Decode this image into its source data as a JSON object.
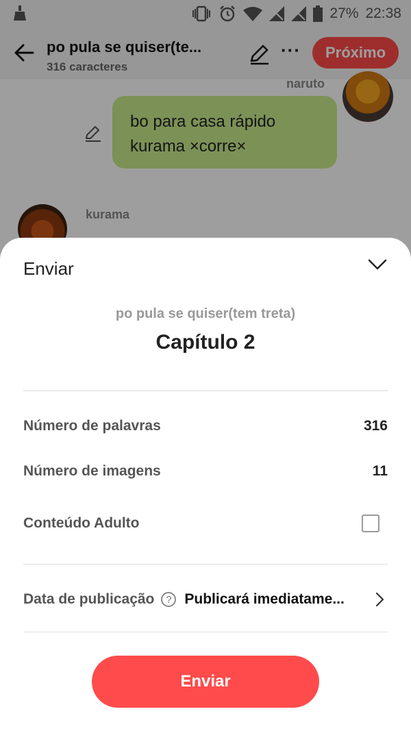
{
  "status_bar": {
    "battery": "27%",
    "time": "22:38"
  },
  "header": {
    "title": "po pula se quiser(te...",
    "subtitle": "316 caracteres",
    "next_button": "Próximo"
  },
  "chat": {
    "right_name": "naruto",
    "bubble_lines": [
      "bo para casa rápido",
      "kurama ×corre×"
    ],
    "left_name": "kurama"
  },
  "sheet": {
    "title": "Enviar",
    "story_title": "po pula se quiser(tem treta)",
    "chapter": "Capítulo 2",
    "rows": [
      {
        "label": "Número de palavras",
        "value": "316"
      },
      {
        "label": "Número de imagens",
        "value": "11"
      },
      {
        "label": "Conteúdo Adulto",
        "checked": false
      }
    ],
    "publish_label": "Data de publicação",
    "publish_help": "?",
    "publish_value": "Publicará imediatame...",
    "send_button": "Enviar"
  },
  "colors": {
    "accent": "#ff4b4b",
    "bubble": "#c8ea8c"
  }
}
